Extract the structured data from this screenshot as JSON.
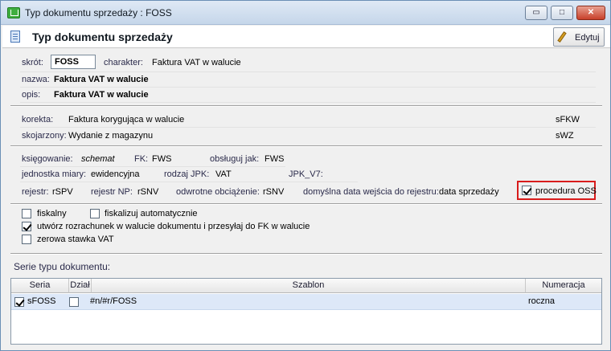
{
  "window": {
    "title": "Typ dokumentu sprzedaży : FOSS",
    "minimize": "▭",
    "maximize": "□",
    "close": "✕"
  },
  "header": {
    "title": "Typ dokumentu sprzedaży",
    "edit_label": "Edytuj"
  },
  "basic": {
    "skrot_label": "skrót:",
    "skrot_value": "FOSS",
    "charakter_label": "charakter:",
    "charakter_value": "Faktura VAT w walucie",
    "nazwa_label": "nazwa:",
    "nazwa_value": "Faktura VAT w walucie",
    "opis_label": "opis:",
    "opis_value": "Faktura VAT w walucie"
  },
  "related": {
    "korekta_label": "korekta:",
    "korekta_value": "Faktura korygująca w walucie",
    "korekta_code": "sFKW",
    "skojarzony_label": "skojarzony:",
    "skojarzony_value": "Wydanie z magazynu",
    "skojarzony_code": "sWZ"
  },
  "accounting": {
    "ksiegowanie_label": "księgowanie:",
    "ksiegowanie_value": "schemat",
    "fk_label": "FK:",
    "fk_value": "FWS",
    "obsluguj_label": "obsługuj jak:",
    "obsluguj_value": "FWS",
    "jednostka_label": "jednostka miary:",
    "jednostka_value": "ewidencyjna",
    "rodzaj_label": "rodzaj JPK:",
    "rodzaj_value": "VAT",
    "jpk_v7_label": "JPK_V7:",
    "rejestr_label": "rejestr:",
    "rejestr_value": "rSPV",
    "rejestr_np_label": "rejestr NP:",
    "rejestr_np_value": "rSNV",
    "odwrotne_label": "odwrotne obciążenie:",
    "odwrotne_value": "rSNV",
    "data_wejscia_label": "domyślna data wejścia do rejestru:",
    "data_wejscia_value": "data sprzedaży",
    "procedura_oss_label": "procedura OSS",
    "procedura_oss_checked": true
  },
  "options": {
    "fiskalny_label": "fiskalny",
    "fiskalny_checked": false,
    "fiskalizuj_label": "fiskalizuj automatycznie",
    "fiskalizuj_checked": false,
    "rozrachunek_label": "utwórz rozrachunek w walucie dokumentu i przesyłaj do FK w walucie",
    "rozrachunek_checked": true,
    "zerowa_label": "zerowa stawka VAT",
    "zerowa_checked": false
  },
  "series": {
    "section_title": "Serie typu dokumentu:",
    "columns": [
      "Seria",
      "Dział",
      "Szablon",
      "Numeracja"
    ],
    "rows": [
      {
        "seria": "sFOSS",
        "seria_checked": true,
        "dzial_checked": false,
        "szablon": "#n/#r/FOSS",
        "numeracja": "roczna"
      }
    ]
  }
}
